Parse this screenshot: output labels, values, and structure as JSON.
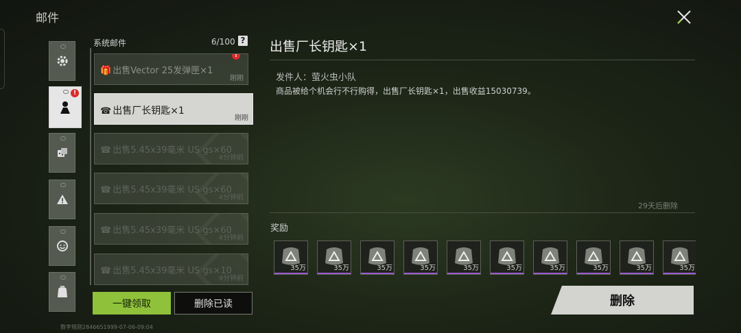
{
  "window": {
    "title": "邮件"
  },
  "categories": {
    "items": [
      {
        "icon": "gear-icon"
      },
      {
        "icon": "user-card-icon",
        "badge": "!"
      },
      {
        "icon": "dice-icon"
      },
      {
        "icon": "warning-icon"
      },
      {
        "icon": "smile-icon"
      },
      {
        "icon": "bag-icon"
      }
    ]
  },
  "mail_list": {
    "title": "系统邮件",
    "count": "6/100",
    "help": "?",
    "items": [
      {
        "subject": "出售Vector 25发弹匣×1",
        "time": "刚刚",
        "icon": "gift-icon",
        "unread": "!"
      },
      {
        "subject": "出售厂长钥匙×1",
        "time": "刚刚",
        "icon": "phone-icon"
      },
      {
        "subject": "出售5.45x39毫米 US gs×60",
        "time": "4分钟前",
        "icon": "phone-icon"
      },
      {
        "subject": "出售5.45x39毫米 US gs×60",
        "time": "4分钟前",
        "icon": "phone-icon"
      },
      {
        "subject": "出售5.45x39毫米 US gs×60",
        "time": "4分钟前",
        "icon": "phone-icon"
      },
      {
        "subject": "出售5.45x39毫米 US gs×10",
        "time": "4分钟前",
        "icon": "phone-icon"
      }
    ],
    "claim_all": "一键领取",
    "delete_read": "删除已读"
  },
  "detail": {
    "title": "出售厂长钥匙×1",
    "sender_label": "发件人：",
    "sender": "萤火虫小队",
    "body": "商品被给个机会行不行购得，出售厂长钥匙×1，出售收益15030739。",
    "expire": "29天后删除",
    "rewards_label": "奖励",
    "rewards": [
      {
        "qty": "35万"
      },
      {
        "qty": "35万"
      },
      {
        "qty": "35万"
      },
      {
        "qty": "35万"
      },
      {
        "qty": "35万"
      },
      {
        "qty": "35万"
      },
      {
        "qty": "35万"
      },
      {
        "qty": "35万"
      },
      {
        "qty": "35万"
      },
      {
        "qty": "35万"
      }
    ],
    "delete": "删除"
  },
  "footer": {
    "text": "数字规则2846651999-07-06-09:04"
  },
  "colors": {
    "accent_green": "#8fc23a",
    "badge_red": "#d92a2a",
    "reward_rarity": "#9b5bd1"
  }
}
